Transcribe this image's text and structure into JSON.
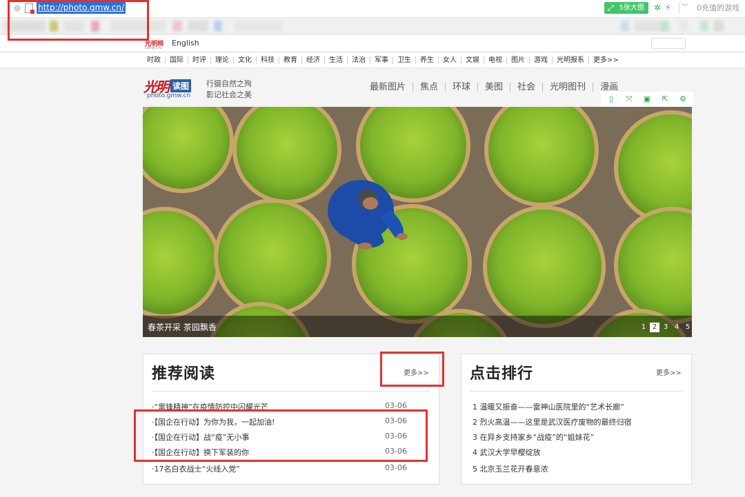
{
  "browser": {
    "url": "http://photo.gmw.cn/",
    "pic_button": "5张大图",
    "game_text": "0充值的游戏",
    "colors": {
      "url_highlight": "#2f6fd6",
      "pic_button": "#43c66b",
      "annotation": "#e0322e"
    }
  },
  "site_top": {
    "logo_text": "光明网",
    "logo_sub": "GMW.CN",
    "english": "English"
  },
  "nav": {
    "items": [
      "时政",
      "国际",
      "时评",
      "理论",
      "文化",
      "科技",
      "教育",
      "经济",
      "生活",
      "法治",
      "军事",
      "卫生",
      "养生",
      "女人",
      "文娱",
      "电视",
      "图片",
      "游戏",
      "光明报系",
      "更多>>"
    ]
  },
  "section": {
    "logo_mark": "光明",
    "logo_badge": "读图",
    "logo_domain": "photo.gmw.cn",
    "slogan_1": "行摄自然之殉",
    "slogan_2": "影记社会之美",
    "tabs": [
      "最新图片",
      "焦点",
      "环球",
      "美图",
      "社会",
      "光明图刊",
      "漫画"
    ]
  },
  "hero": {
    "caption": "春茶开采 茶园飘香",
    "pages": [
      "1",
      "2",
      "3",
      "4",
      "5"
    ],
    "active_page": 2,
    "tools": [
      "phone-icon",
      "fullscreen-icon",
      "save-icon",
      "share-icon",
      "settings-icon"
    ]
  },
  "recommend": {
    "title": "推荐阅读",
    "more": "更多>>",
    "items": [
      {
        "title": "·“雷锋精神”在疫情防控中闪耀光芒",
        "date": "03-06"
      },
      {
        "title": "·【国企在行动】为你为我，一起加油!",
        "date": "03-06"
      },
      {
        "title": "·【国企在行动】战“疫”无小事",
        "date": "03-06"
      },
      {
        "title": "·【国企在行动】换下军装的你",
        "date": "03-06"
      },
      {
        "title": "·17名白衣战士“火线入党”",
        "date": "03-06"
      }
    ]
  },
  "ranking": {
    "title": "点击排行",
    "more": "更多>>",
    "items": [
      "1 温暖又振奋——雷神山医院里的“艺术长廊”",
      "2 烈火高温——这里是武汉医疗废物的最终归宿",
      "3 在异乡支持家乡“战疫”的“姐妹花”",
      "4 武汉大学早樱绽放",
      "5 北京玉兰花开春意浓"
    ]
  }
}
